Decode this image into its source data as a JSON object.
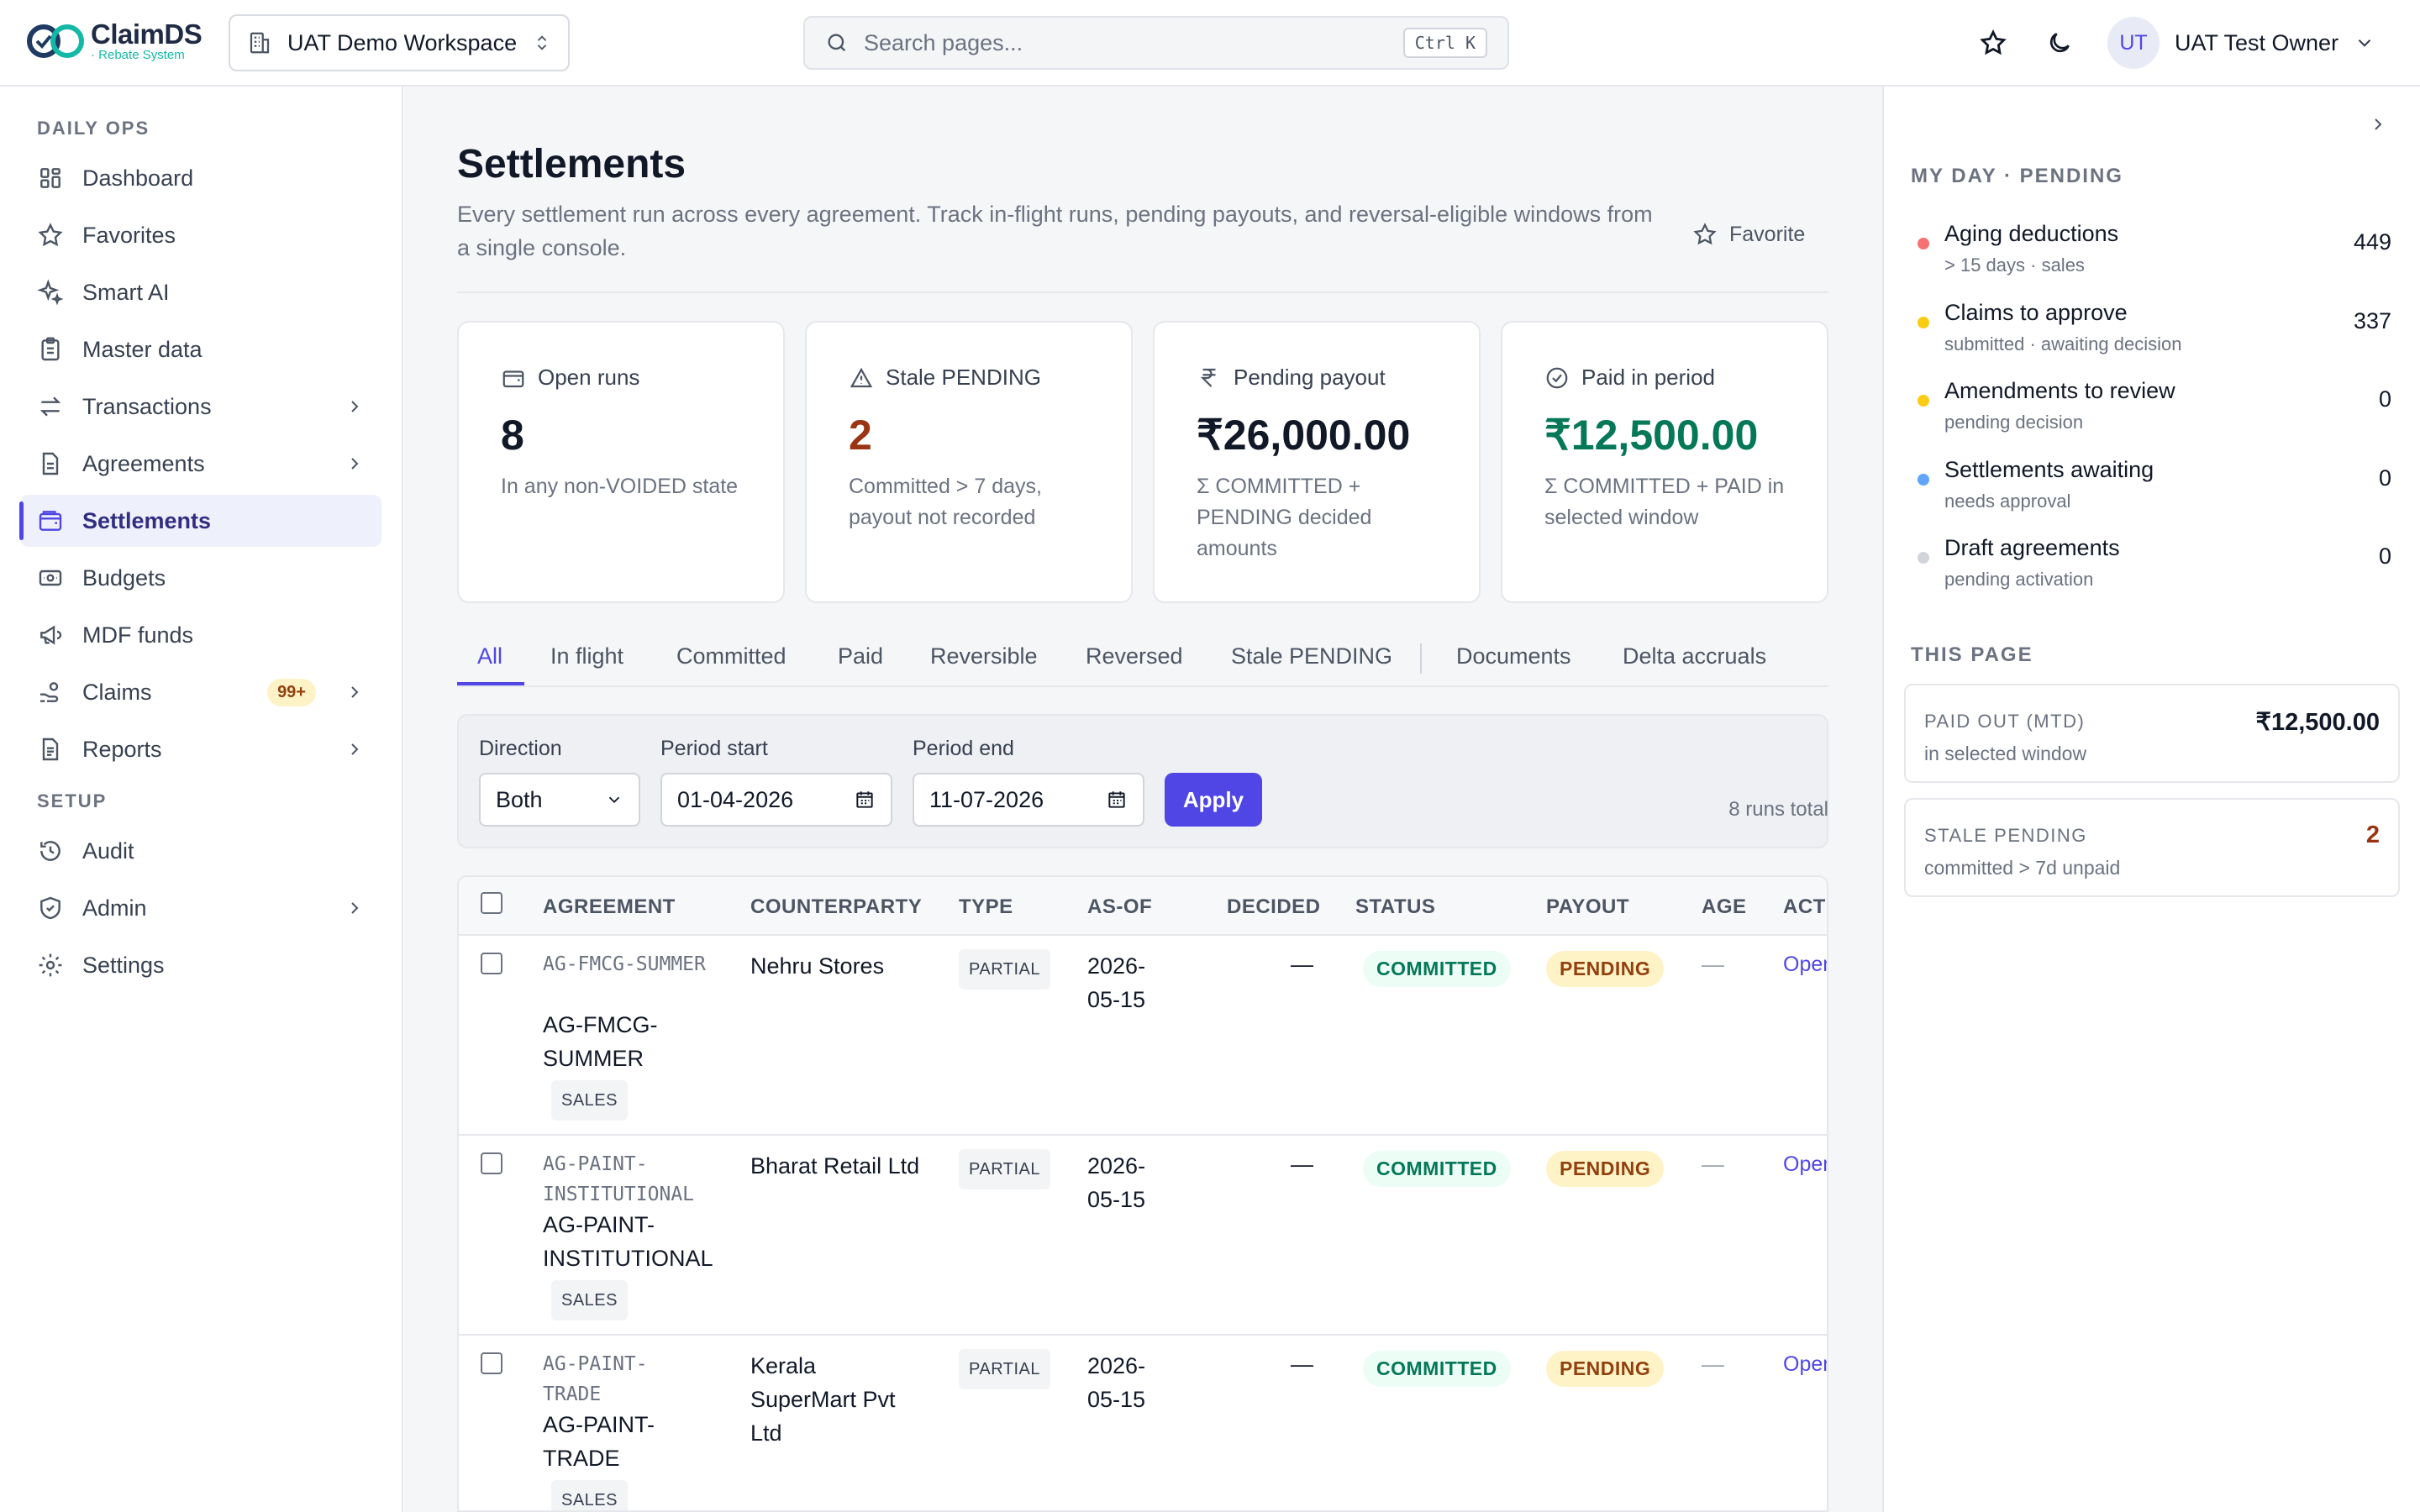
{
  "app": {
    "name": "ClaimDS",
    "tagline": "· Rebate System"
  },
  "workspace": {
    "name": "UAT Demo Workspace"
  },
  "search": {
    "placeholder": "Search pages...",
    "shortcut": "Ctrl K"
  },
  "user": {
    "initials": "UT",
    "name": "UAT Test Owner"
  },
  "sidebar": {
    "sections": [
      {
        "label": "DAILY OPS"
      },
      {
        "label": "SETUP"
      }
    ],
    "items": [
      {
        "label": "Dashboard",
        "icon": "grid-icon"
      },
      {
        "label": "Favorites",
        "icon": "star-icon"
      },
      {
        "label": "Smart AI",
        "icon": "sparkle-icon"
      },
      {
        "label": "Master data",
        "icon": "clipboard-icon"
      },
      {
        "label": "Transactions",
        "icon": "arrows-icon",
        "has_children": true
      },
      {
        "label": "Agreements",
        "icon": "document-icon",
        "has_children": true
      },
      {
        "label": "Settlements",
        "icon": "wallet-icon",
        "active": true
      },
      {
        "label": "Budgets",
        "icon": "banknote-icon"
      },
      {
        "label": "MDF funds",
        "icon": "megaphone-icon"
      },
      {
        "label": "Claims",
        "icon": "hand-coins-icon",
        "badge": "99+",
        "has_children": true
      },
      {
        "label": "Reports",
        "icon": "report-icon",
        "has_children": true
      },
      {
        "label": "Audit",
        "icon": "history-icon"
      },
      {
        "label": "Admin",
        "icon": "shield-icon",
        "has_children": true
      },
      {
        "label": "Settings",
        "icon": "gear-icon"
      }
    ]
  },
  "page": {
    "title": "Settlements",
    "subtitle": "Every settlement run across every agreement. Track in-flight runs, pending payouts, and reversal-eligible windows from a single console.",
    "favorite_label": "Favorite"
  },
  "cards": [
    {
      "label": "Open runs",
      "value": "8",
      "desc": "In any non-VOIDED state",
      "value_color": "#111827"
    },
    {
      "label": "Stale PENDING",
      "value": "2",
      "desc": "Committed > 7 days, payout not recorded",
      "value_color": "#9a3412"
    },
    {
      "label": "Pending payout",
      "value": "₹26,000.00",
      "desc": "Σ COMMITTED + PENDING decided amounts",
      "value_color": "#111827"
    },
    {
      "label": "Paid in period",
      "value": "₹12,500.00",
      "desc": "Σ COMMITTED + PAID in selected window",
      "value_color": "#047857"
    }
  ],
  "tabs": [
    "All",
    "In flight",
    "Committed",
    "Paid",
    "Reversible",
    "Reversed",
    "Stale PENDING",
    "Documents",
    "Delta accruals"
  ],
  "active_tab": "All",
  "filters": {
    "direction_label": "Direction",
    "direction_value": "Both",
    "period_start_label": "Period start",
    "period_start_value": "01-04-2026",
    "period_end_label": "Period end",
    "period_end_value": "11-07-2026",
    "apply_label": "Apply",
    "runs_total": "8 runs total"
  },
  "table": {
    "columns": [
      "AGREEMENT",
      "COUNTERPARTY",
      "TYPE",
      "AS-OF",
      "DECIDED",
      "STATUS",
      "PAYOUT",
      "AGE",
      "ACTI"
    ],
    "rows": [
      {
        "code": "AG-FMCG-SUMMER",
        "name": "AG-FMCG-SUMMER",
        "scope": "SALES",
        "counterparty": "Nehru Stores",
        "type": "PARTIAL",
        "as_of": "2026-05-15",
        "decided": "—",
        "status": "COMMITTED",
        "payout": "PENDING",
        "age": "—",
        "action": "Open"
      },
      {
        "code": "AG-PAINT-INSTITUTIONAL",
        "name": "AG-PAINT-INSTITUTIONAL",
        "scope": "SALES",
        "counterparty": "Bharat Retail Ltd",
        "type": "PARTIAL",
        "as_of": "2026-05-15",
        "decided": "—",
        "status": "COMMITTED",
        "payout": "PENDING",
        "age": "—",
        "action": "Open"
      },
      {
        "code": "AG-PAINT-TRADE",
        "name": "AG-PAINT-TRADE",
        "scope": "SALES",
        "counterparty": "Kerala SuperMart Pvt Ltd",
        "type": "PARTIAL",
        "as_of": "2026-05-15",
        "decided": "—",
        "status": "COMMITTED",
        "payout": "PENDING",
        "age": "—",
        "action": "Open"
      }
    ]
  },
  "right_panel": {
    "my_day_title": "MY DAY · PENDING",
    "items": [
      {
        "title": "Aging deductions",
        "sub": "> 15 days · sales",
        "count": "449",
        "color": "#f87171"
      },
      {
        "title": "Claims to approve",
        "sub": "submitted · awaiting decision",
        "count": "337",
        "color": "#facc15"
      },
      {
        "title": "Amendments to review",
        "sub": "pending decision",
        "count": "0",
        "color": "#facc15"
      },
      {
        "title": "Settlements awaiting",
        "sub": "needs approval",
        "count": "0",
        "color": "#60a5fa"
      },
      {
        "title": "Draft agreements",
        "sub": "pending activation",
        "count": "0",
        "color": "#d1d5db"
      }
    ],
    "this_page_title": "THIS PAGE",
    "stats": [
      {
        "title": "PAID OUT (MTD)",
        "sub": "in selected window",
        "value": "₹12,500.00",
        "color": "#111827"
      },
      {
        "title": "STALE PENDING",
        "sub": "committed > 7d unpaid",
        "value": "2",
        "color": "#9a3412"
      }
    ]
  }
}
